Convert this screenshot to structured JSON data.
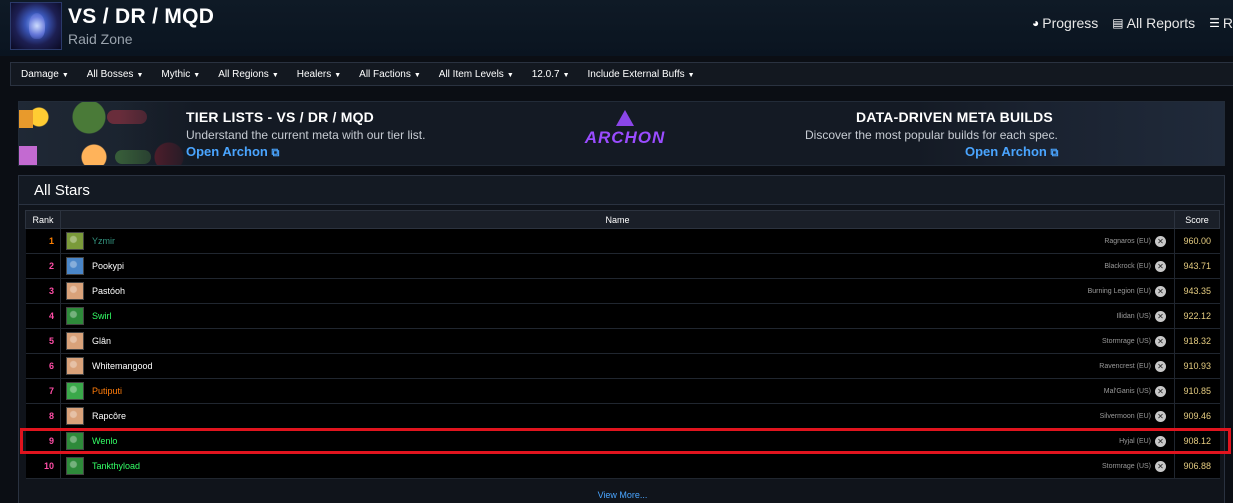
{
  "header": {
    "title": "VS / DR / MQD",
    "subtitle": "Raid Zone",
    "nav": [
      {
        "icon": "globe-icon",
        "label": "Progress"
      },
      {
        "icon": "reports-icon",
        "label": "All Reports"
      },
      {
        "icon": "rankings-icon",
        "label": "R"
      }
    ]
  },
  "filters": [
    "Damage",
    "All Bosses",
    "Mythic",
    "All Regions",
    "Healers",
    "All Factions",
    "All Item Levels",
    "12.0.7",
    "Include External Buffs"
  ],
  "banner": {
    "left_heading": "TIER LISTS - VS / DR / MQD",
    "left_text": "Understand the current meta with our tier list.",
    "left_link": "Open Archon",
    "logo_text": "ARCHON",
    "right_heading": "DATA-DRIVEN META BUILDS",
    "right_text": "Discover the most popular builds for each spec.",
    "right_link": "Open Archon"
  },
  "panel": {
    "title": "All Stars",
    "columns": {
      "rank": "Rank",
      "name": "Name",
      "score": "Score"
    },
    "rows": [
      {
        "rank": "1",
        "name": "Yzmir",
        "server": "Ragnaros (EU)",
        "score": "960.00",
        "rank_color": "#ff8000",
        "name_color": "#33937f",
        "icon_color": "#7a9a3a"
      },
      {
        "rank": "2",
        "name": "Pookypi",
        "server": "Blackrock (EU)",
        "score": "943.71",
        "rank_color": "#ff4da6",
        "name_color": "#ffffff",
        "icon_color": "#4a86c8"
      },
      {
        "rank": "3",
        "name": "Pastóoh",
        "server": "Burning Legion (EU)",
        "score": "943.35",
        "rank_color": "#ff4da6",
        "name_color": "#ffffff",
        "icon_color": "#d9a27a"
      },
      {
        "rank": "4",
        "name": "Swirl",
        "server": "Illidan (US)",
        "score": "922.12",
        "rank_color": "#ff4da6",
        "name_color": "#33ff66",
        "icon_color": "#2e8a3a"
      },
      {
        "rank": "5",
        "name": "Glân",
        "server": "Stormrage (US)",
        "score": "918.32",
        "rank_color": "#ff4da6",
        "name_color": "#ffffff",
        "icon_color": "#d9a27a"
      },
      {
        "rank": "6",
        "name": "Whitemangood",
        "server": "Ravencrest (EU)",
        "score": "910.93",
        "rank_color": "#ff4da6",
        "name_color": "#ffffff",
        "icon_color": "#d9a27a"
      },
      {
        "rank": "7",
        "name": "Putiputi",
        "server": "Mal'Ganis (US)",
        "score": "910.85",
        "rank_color": "#ff4da6",
        "name_color": "#ff7c0a",
        "icon_color": "#3aa84a"
      },
      {
        "rank": "8",
        "name": "Rapcôre",
        "server": "Silvermoon (EU)",
        "score": "909.46",
        "rank_color": "#ff4da6",
        "name_color": "#ffffff",
        "icon_color": "#d9a27a"
      },
      {
        "rank": "9",
        "name": "Wenlo",
        "server": "Hyjal (EU)",
        "score": "908.12",
        "rank_color": "#ff4da6",
        "name_color": "#33ff66",
        "icon_color": "#2e8a3a"
      },
      {
        "rank": "10",
        "name": "Tankthyload",
        "server": "Stormrage (US)",
        "score": "906.88",
        "rank_color": "#ff4da6",
        "name_color": "#33ff66",
        "icon_color": "#2e8a3a"
      }
    ],
    "view_more": "View More..."
  },
  "highlight_color": "#e0141e"
}
